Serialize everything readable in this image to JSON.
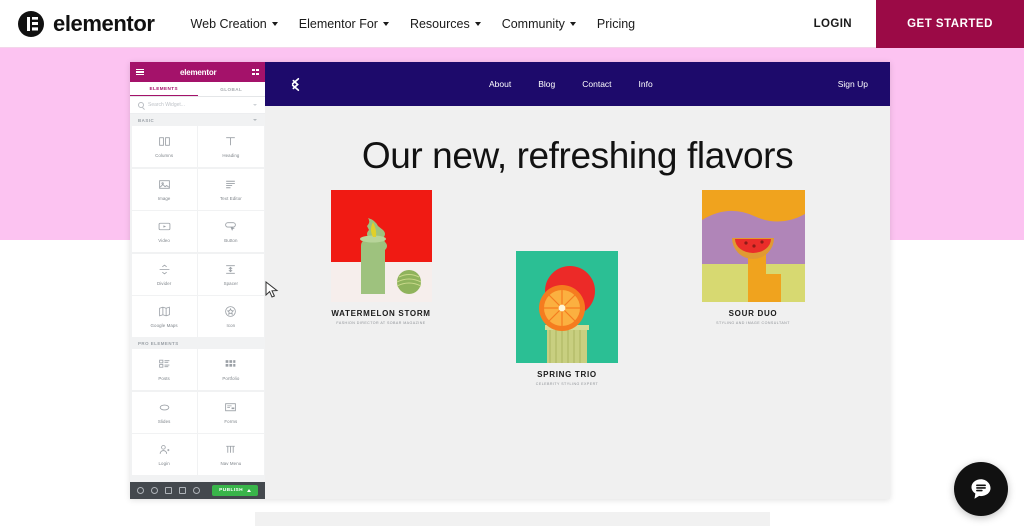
{
  "header": {
    "brand": "elementor",
    "brand_icon": "elementor-logo-icon",
    "nav": [
      {
        "label": "Web Creation",
        "has_dropdown": true
      },
      {
        "label": "Elementor For",
        "has_dropdown": true
      },
      {
        "label": "Resources",
        "has_dropdown": true
      },
      {
        "label": "Community",
        "has_dropdown": true
      },
      {
        "label": "Pricing",
        "has_dropdown": false
      }
    ],
    "login_label": "LOGIN",
    "cta_label": "GET STARTED",
    "cta_color": "#9b0a46"
  },
  "band": {
    "color": "#fcc3f1"
  },
  "editor": {
    "panel": {
      "title": "elementor",
      "menu_icon": "hamburger-icon",
      "layout_icon": "grid-icon",
      "tabs": [
        {
          "label": "ELEMENTS",
          "active": true
        },
        {
          "label": "GLOBAL",
          "active": false
        }
      ],
      "search_placeholder": "Search Widget...",
      "search_value": "",
      "sections": [
        {
          "label": "BASIC",
          "widgets": [
            {
              "label": "Columns",
              "icon": "columns-icon"
            },
            {
              "label": "Heading",
              "icon": "heading-icon"
            },
            {
              "label": "Image",
              "icon": "image-icon"
            },
            {
              "label": "Text Editor",
              "icon": "text-editor-icon"
            },
            {
              "label": "Video",
              "icon": "video-icon"
            },
            {
              "label": "Button",
              "icon": "button-icon"
            },
            {
              "label": "Divider",
              "icon": "divider-icon"
            },
            {
              "label": "Spacer",
              "icon": "spacer-icon"
            },
            {
              "label": "Google Maps",
              "icon": "map-icon"
            },
            {
              "label": "Icon",
              "icon": "star-icon"
            }
          ]
        },
        {
          "label": "PRO ELEMENTS",
          "widgets": [
            {
              "label": "Posts",
              "icon": "posts-icon"
            },
            {
              "label": "Portfolio",
              "icon": "portfolio-icon"
            },
            {
              "label": "Slides",
              "icon": "slides-icon"
            },
            {
              "label": "Forms",
              "icon": "forms-icon"
            },
            {
              "label": "Login",
              "icon": "login-icon"
            },
            {
              "label": "Nav Menu",
              "icon": "nav-menu-icon"
            }
          ]
        }
      ],
      "footer": {
        "icons": [
          "settings-icon",
          "navigator-icon",
          "history-icon",
          "responsive-icon",
          "preview-icon"
        ],
        "publish_label": "PUBLISH",
        "publish_color": "#39b54a"
      },
      "collapse_handle": "panel-collapse-handle"
    },
    "preview": {
      "navbar": {
        "logo": "site-logo-icon",
        "links": [
          "About",
          "Blog",
          "Contact",
          "Info"
        ],
        "signup_label": "Sign Up",
        "background": "#1d0a6b"
      },
      "hero_title": "Our new, refreshing flavors",
      "cards": [
        {
          "title": "WATERMELON STORM",
          "subtitle": "FASHION DIRECTOR AT SOBAR MAGAZINE",
          "art": "watermelon-storm-artwork",
          "bg": "#f01a13",
          "accent": "#9ec27e"
        },
        {
          "title": "SPRING TRIO",
          "subtitle": "CELEBRITY STYLING EXPERT",
          "art": "spring-trio-artwork",
          "bg": "#2bbf94",
          "accent": "#f37021"
        },
        {
          "title": "SOUR DUO",
          "subtitle": "STYLING AND IMAGE CONSULTANT",
          "art": "sour-duo-artwork",
          "bg": "#f0a31e",
          "accent": "#b085b8"
        }
      ]
    }
  },
  "chat_widget": {
    "icon": "chat-bubble-icon"
  },
  "cursor": {
    "icon": "mouse-pointer-icon"
  }
}
